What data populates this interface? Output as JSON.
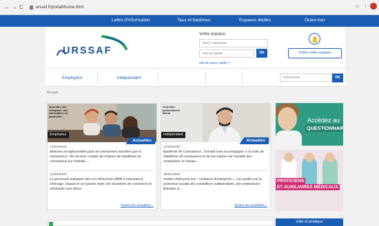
{
  "browser": {
    "url": "urssaf.fr/portail/home.html"
  },
  "topnav": [
    "Lettre d'information",
    "Taux et barèmes",
    "Espaces dédiés",
    "Outre-mer"
  ],
  "header": {
    "logo_text": "URSSAF",
    "espace_title": "Votre espace",
    "siret_placeholder": "Siret / Identifiant",
    "password_placeholder": "Mot de passe",
    "ok_label": "OK",
    "forgot_label": "Mot de passe oublié ?",
    "create_label": "Créer votre espace"
  },
  "nav2": {
    "employeur": "Employeur",
    "independant": "Indépendant",
    "search_placeholder": "Rechercher",
    "search_ok": "OK"
  },
  "breadcrumb": "Accueil",
  "cards": [
    {
      "photo_text": "Vous êtes une entreprise, une association, un particulier...",
      "badge": "Employeur",
      "actu_label": "Actualités",
      "news": [
        {
          "date": "13/03/2020",
          "text": "Mesures exceptionnelles pour les entreprises touchées par le coronavirus. Afin de tenir compte de l'impact de l'épidémie de coronavirus sur l'activité ..."
        },
        {
          "date": "12/03/2020",
          "text": "Le personnel statutaire des CCI désormais affilié à l'assurance chômage. Depuis le 1er janvier 2020, les chambres de commerce et d'industrie sont désor ..."
        }
      ],
      "all_news": "Toutes les actualités..."
    },
    {
      "photo_text": "Vous êtes professionnel libéral",
      "badge": "Indépendant",
      "actu_label": "Actualités",
      "news": [
        {
          "date": "12/03/2020",
          "text": "Épidémie de Coronavirus : l'Urssaf vous accompagne. À la suite de l'épidémie de coronavirus et de son impact sur l'activité des entreprises, le réseau ..."
        },
        {
          "date": "28/01/2020",
          "text": "Guides 2020 pour les « créateurs d'entreprise ». Les guides sur la protection sociale des travailleurs indépendants, des professions libérales et ..."
        }
      ],
      "all_news": "Toutes les actualités..."
    }
  ],
  "promo1": {
    "line1": "Accédez au",
    "line2": "QUESTIONNAIRE"
  },
  "promo2": {
    "line1": "PRATICIENS",
    "line2": "ET AUXILIAIRES MÉDICAUX"
  },
  "bottom_right": "Utile et pratique"
}
